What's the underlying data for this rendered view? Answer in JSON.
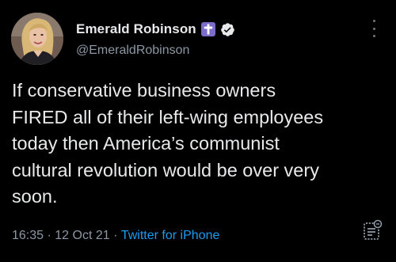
{
  "tweet": {
    "author": {
      "display_name": "Emerald Robinson",
      "handle": "@EmeraldRobinson",
      "badges": [
        "latin-cross-emoji",
        "verified-icon"
      ]
    },
    "text": "If conservative business owners\nFIRED all of their left-wing employees\ntoday then America’s communist\ncultural revolution would be over very\nsoon.",
    "meta": {
      "time": "16:35",
      "separator_1": " · ",
      "date": "12 Oct 21",
      "separator_2": " · ",
      "source": "Twitter for iPhone"
    },
    "icons": {
      "more": "more-vertical-icon",
      "analytics": "tweet-analytics-icon"
    }
  },
  "colors": {
    "background": "#000000",
    "primary_text": "#e7e9ea",
    "secondary_text": "#8b98a5",
    "link": "#1d9bf0",
    "cross_badge_bg": "#7a6cc9"
  }
}
